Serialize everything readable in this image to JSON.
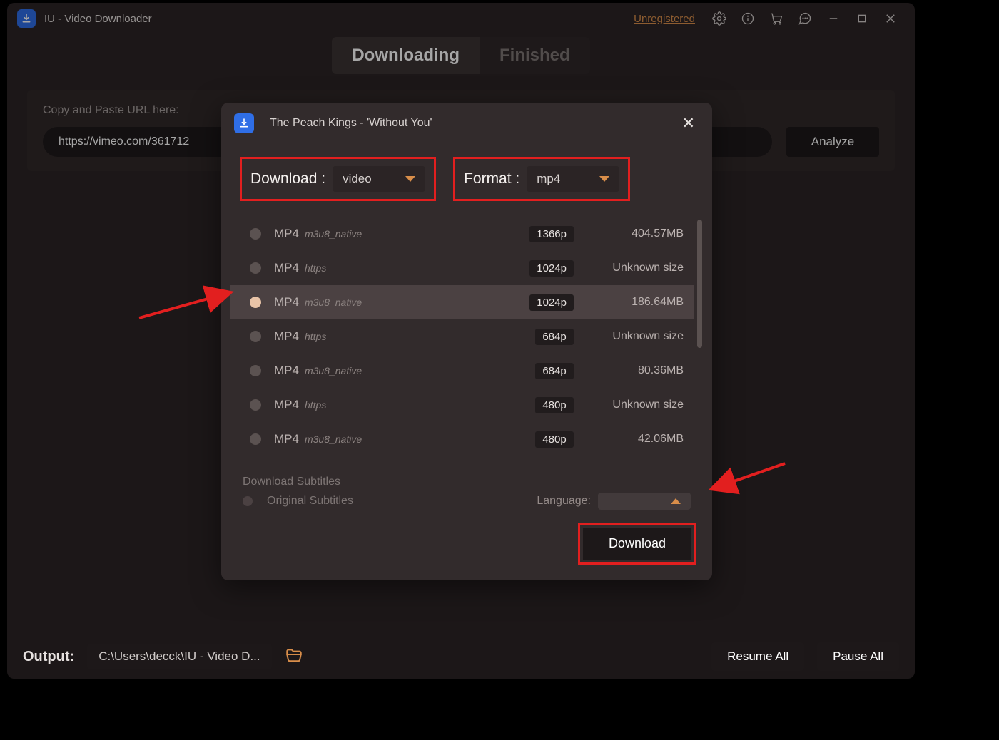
{
  "app": {
    "title": "IU - Video Downloader",
    "unregistered": "Unregistered"
  },
  "tabs": {
    "downloading": "Downloading",
    "finished": "Finished"
  },
  "url": {
    "label_prefix": "Copy and Paste URL here:",
    "value": "https://vimeo.com/361712",
    "analyze": "Analyze"
  },
  "dialog": {
    "title": "The Peach Kings - 'Without You'",
    "download_label": "Download :",
    "download_value": "video",
    "format_label": "Format :",
    "format_value": "mp4",
    "subtitles_header": "Download Subtitles",
    "subtitles_orig": "Original Subtitles",
    "language_label": "Language:",
    "download_btn": "Download",
    "selected_index": 2,
    "qualities": [
      {
        "fmt": "MP4",
        "meta": "m3u8_native",
        "res": "1366p",
        "size": "404.57MB"
      },
      {
        "fmt": "MP4",
        "meta": "https",
        "res": "1024p",
        "size": "Unknown size"
      },
      {
        "fmt": "MP4",
        "meta": "m3u8_native",
        "res": "1024p",
        "size": "186.64MB"
      },
      {
        "fmt": "MP4",
        "meta": "https",
        "res": "684p",
        "size": "Unknown size"
      },
      {
        "fmt": "MP4",
        "meta": "m3u8_native",
        "res": "684p",
        "size": "80.36MB"
      },
      {
        "fmt": "MP4",
        "meta": "https",
        "res": "480p",
        "size": "Unknown size"
      },
      {
        "fmt": "MP4",
        "meta": "m3u8_native",
        "res": "480p",
        "size": "42.06MB"
      }
    ]
  },
  "output": {
    "label": "Output:",
    "path": "C:\\Users\\decck\\IU - Video D...",
    "resume": "Resume All",
    "pause": "Pause All"
  }
}
